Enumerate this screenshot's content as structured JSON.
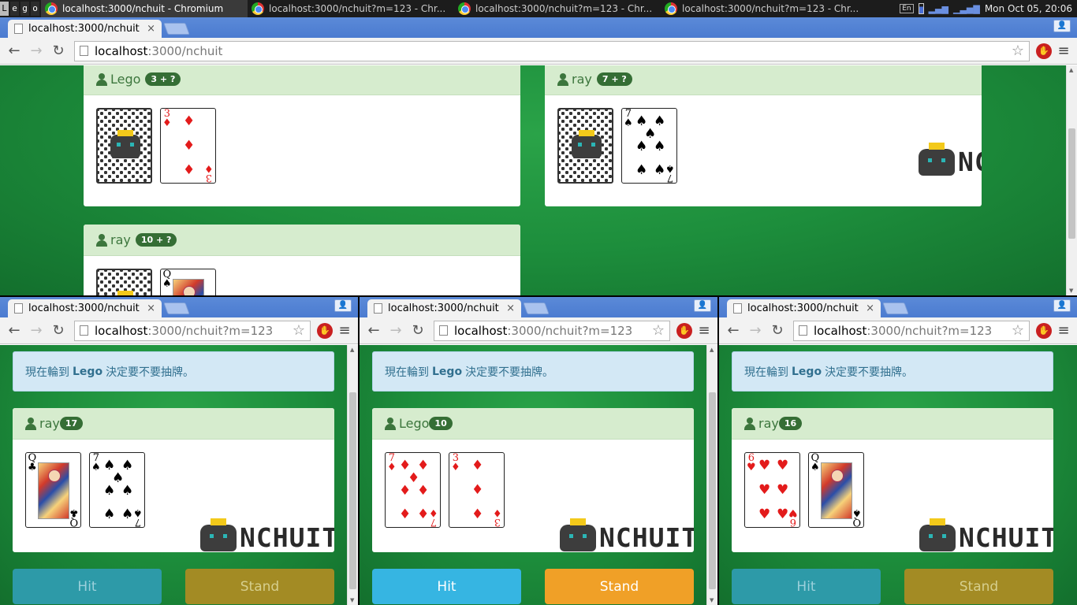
{
  "taskbar": {
    "workspaces": [
      "L",
      "e",
      "g",
      "o"
    ],
    "tasks": [
      {
        "title": "localhost:3000/nchuit - Chromium",
        "active": true
      },
      {
        "title": "localhost:3000/nchuit?m=123 - Chr...",
        "active": false
      },
      {
        "title": "localhost:3000/nchuit?m=123 - Chr...",
        "active": false
      },
      {
        "title": "localhost:3000/nchuit?m=123 - Chr...",
        "active": false
      }
    ],
    "keyboard": "En",
    "clock": "Mon Oct 05, 20:06"
  },
  "top_window": {
    "tab_title": "localhost:3000/nchuit",
    "url_host": "localhost",
    "url_path": ":3000/nchuit",
    "players": [
      {
        "name": "Lego",
        "score": "3 + ?"
      },
      {
        "name": "ray",
        "score": "7 + ?"
      },
      {
        "name": "ray",
        "score": "10 + ?"
      }
    ],
    "logo_text": "NCHUIT"
  },
  "sub_windows": [
    {
      "tab_title": "localhost:3000/nchuit",
      "url_host": "localhost",
      "url_path": ":3000/nchuit?m=123",
      "alert_prefix": "現在輪到",
      "alert_name": "Lego",
      "alert_suffix": "決定要不要抽牌。",
      "player_name": "ray",
      "player_score": "17",
      "hit_label": "Hit",
      "stand_label": "Stand",
      "logo_text": "NCHUIT"
    },
    {
      "tab_title": "localhost:3000/nchuit",
      "url_host": "localhost",
      "url_path": ":3000/nchuit?m=123",
      "alert_prefix": "現在輪到",
      "alert_name": "Lego",
      "alert_suffix": "決定要不要抽牌。",
      "player_name": "Lego",
      "player_score": "10",
      "hit_label": "Hit",
      "stand_label": "Stand",
      "logo_text": "NCHUIT"
    },
    {
      "tab_title": "localhost:3000/nchuit",
      "url_host": "localhost",
      "url_path": ":3000/nchuit?m=123",
      "alert_prefix": "現在輪到",
      "alert_name": "Lego",
      "alert_suffix": "決定要不要抽牌。",
      "player_name": "ray",
      "player_score": "16",
      "hit_label": "Hit",
      "stand_label": "Stand",
      "logo_text": "NCHUIT"
    }
  ],
  "cards": {
    "three_diamonds": {
      "rank": "3",
      "suit": "♦"
    },
    "seven_spades": {
      "rank": "7",
      "suit": "♠"
    },
    "queen_clubs": {
      "rank": "Q",
      "suit": "♣"
    },
    "queen_spades": {
      "rank": "Q",
      "suit": "♠"
    },
    "seven_diamonds": {
      "rank": "7",
      "suit": "♦"
    },
    "six_hearts": {
      "rank": "6",
      "suit": "♥"
    }
  },
  "icons": {
    "back": "←",
    "forward": "→",
    "reload": "↻",
    "star": "☆",
    "menu": "≡",
    "close": "×",
    "stop": "✋"
  },
  "colors": {
    "felt": "#1d8e3c",
    "hit": "#36b5e2",
    "stand": "#f0a027",
    "panel_head": "#d6ecce"
  }
}
